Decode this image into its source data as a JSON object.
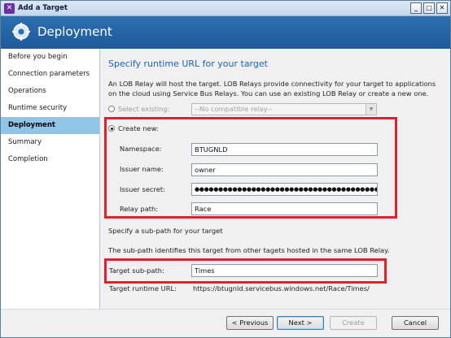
{
  "window": {
    "title": "Add a Target",
    "app_icon_glyph": "✕",
    "caption": {
      "minimize": "_",
      "maximize": "□",
      "close": "✕"
    }
  },
  "header": {
    "title": "Deployment",
    "icon": "gear-icon"
  },
  "sidebar": {
    "items": [
      {
        "label": "Before you begin",
        "active": false
      },
      {
        "label": "Connection parameters",
        "active": false
      },
      {
        "label": "Operations",
        "active": false
      },
      {
        "label": "Runtime security",
        "active": false
      },
      {
        "label": "Deployment",
        "active": true
      },
      {
        "label": "Summary",
        "active": false
      },
      {
        "label": "Completion",
        "active": false
      }
    ]
  },
  "main": {
    "section_title": "Specify runtime URL for your target",
    "description": "An LOB Relay will host the target. LOB Relays provide connectivity for your target to applications on the cloud using Service Bus Relays. You can use an existing LOB Relay or create a new one.",
    "select_existing": {
      "label": "Select existing:",
      "value": "--No compatible relay--"
    },
    "create_new": {
      "label": "Create new:",
      "fields": {
        "namespace_label": "Namespace:",
        "namespace_value": "BTUGNLD",
        "issuer_name_label": "Issuer name:",
        "issuer_name_value": "owner",
        "issuer_secret_label": "Issuer secret:",
        "issuer_secret_value": "●●●●●●●●●●●●●●●●●●●●●●●●●●●●●●●●●●●●●●●●●●●●",
        "relay_path_label": "Relay path:",
        "relay_path_value": "Race"
      }
    },
    "subpath": {
      "heading": "Specify a sub-path for your target",
      "description": "The sub-path identifies this target from other tagets hosted in the same LOB Relay.",
      "target_subpath_label": "Target sub-path:",
      "target_subpath_value": "Times",
      "runtime_url_label": "Target runtime URL:",
      "runtime_url_value": "https://btugnld.servicebus.windows.net/Race/Times/"
    }
  },
  "footer": {
    "previous": "< Previous",
    "next": "Next >",
    "create": "Create",
    "cancel": "Cancel"
  },
  "colors": {
    "header_blue": "#2c6fb0",
    "highlight_red": "#e0202a",
    "title_blue": "#1b63b5",
    "active_nav": "#90c5e8"
  }
}
